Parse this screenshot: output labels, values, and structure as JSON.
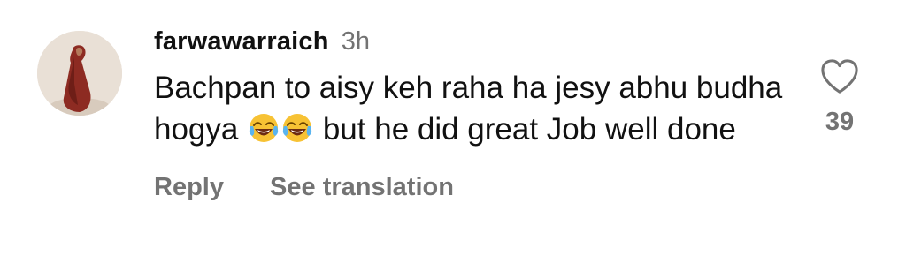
{
  "comment": {
    "username": "farwawarraich",
    "time": "3h",
    "text_part1": "Bachpan to aisy keh raha ha jesy abhu budha hogya",
    "emojis": [
      "face-with-tears-of-joy-icon",
      "face-with-tears-of-joy-icon"
    ],
    "text_part2": "but he did great Job well done",
    "actions": {
      "reply_label": "Reply",
      "translate_label": "See translation"
    },
    "like": {
      "icon": "heart-outline-icon",
      "count": "39"
    }
  },
  "colors": {
    "primary_text": "#111111",
    "secondary_text": "#737373",
    "background": "#ffffff"
  }
}
